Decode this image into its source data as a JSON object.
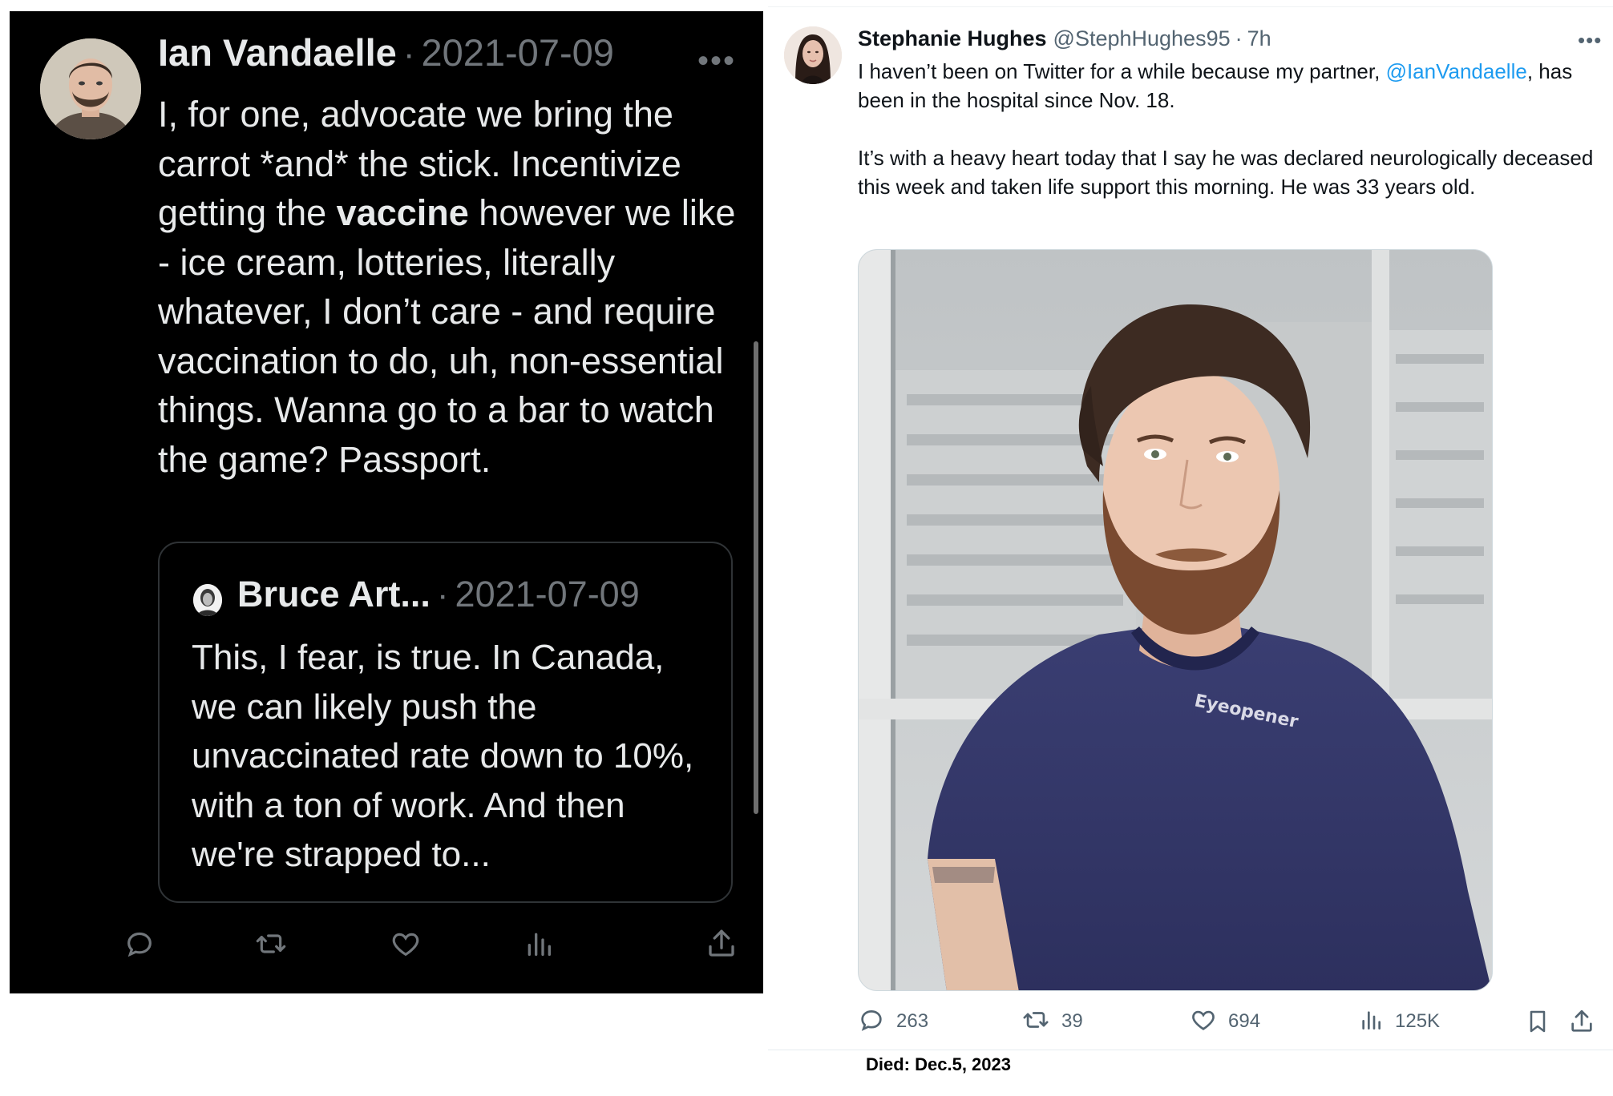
{
  "left_tweet": {
    "author_name": "Ian Vandaelle",
    "date": "2021-07-09",
    "more_icon": "more-horizontal-icon",
    "text_before": "I, for one, advocate we bring the carrot *and* the stick. Incentivize getting the ",
    "text_bold": "vaccine",
    "text_after": " however we like - ice cream, lotteries, literally whatever, I don’t care - and require vaccination to do, uh, non-essential things. Wanna go to a bar to watch the game? Passport.",
    "quote": {
      "author_name": "Bruce Art...",
      "date": "2021-07-09",
      "text": "This, I fear, is true. In Canada, we can likely push the unvaccinated rate down to 10%, with a ton of work. And then we're strapped to..."
    },
    "actions": [
      "reply-icon",
      "retweet-icon",
      "like-icon",
      "views-icon",
      "share-icon"
    ]
  },
  "right_tweet": {
    "author_name": "Stephanie Hughes",
    "handle": "@StephHughes95",
    "time": "7h",
    "text_p1_before": "I haven’t been on Twitter for a while because my partner, ",
    "mention": "@IanVandaelle",
    "text_p1_after": ", has been in the hospital since Nov. 18.",
    "text_p2": "It’s with a heavy heart today that I say he was declared neurologically deceased this week and taken life support this morning. He was 33 years old.",
    "shirt_text": "Eyeopener",
    "actions": {
      "replies": "263",
      "retweets": "39",
      "likes": "694",
      "views": "125K"
    }
  },
  "caption": "Died: Dec.5, 2023",
  "colors": {
    "dark_bg": "#000000",
    "dark_text": "#e7e9ea",
    "dark_muted": "#71767b",
    "light_text": "#0f1419",
    "light_muted": "#536471",
    "link": "#1d9bf0"
  }
}
